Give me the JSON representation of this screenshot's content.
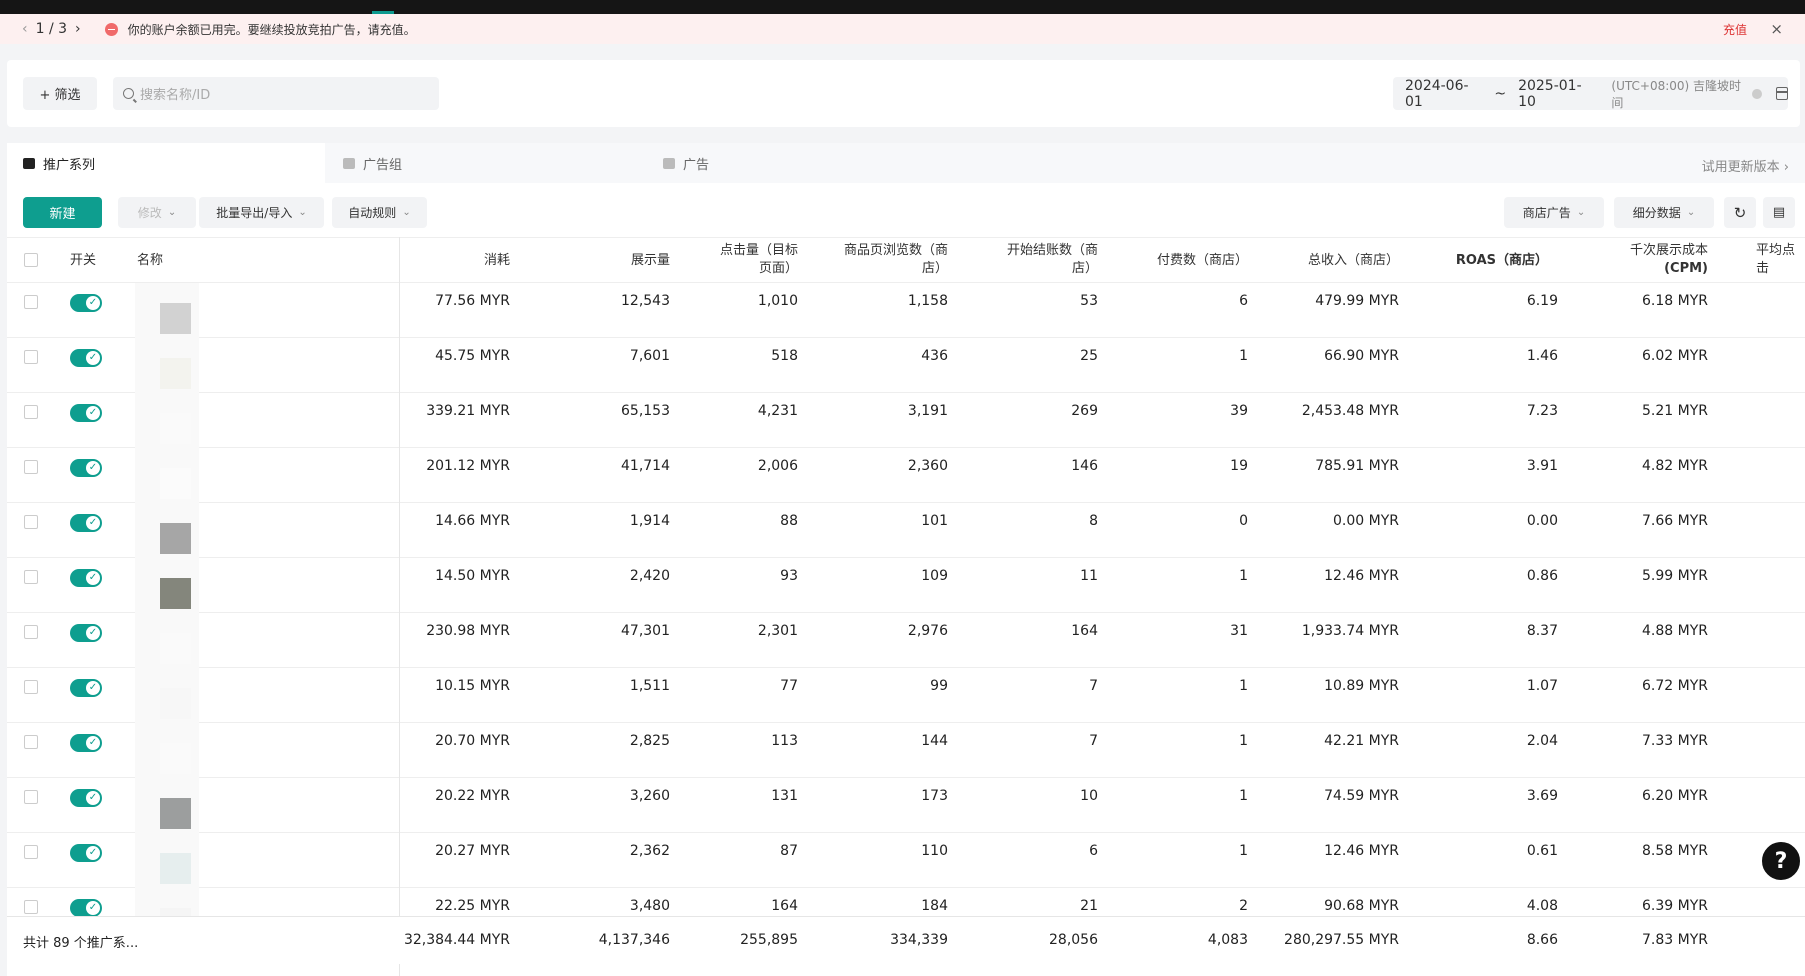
{
  "alert": {
    "page_indicator": "1 / 3",
    "message": "你的账户余额已用完。要继续投放竞拍广告，请充值。",
    "recharge_label": "充值"
  },
  "filter": {
    "filter_button_label": "+ 筛选",
    "search_placeholder": "搜索名称/ID",
    "start_date": "2024-06-01",
    "separator": "~",
    "end_date": "2025-01-10",
    "timezone": "(UTC+08:00) 吉隆坡时间"
  },
  "tabs": [
    {
      "label": "推广系列",
      "active": true
    },
    {
      "label": "广告组",
      "active": false
    },
    {
      "label": "广告",
      "active": false
    }
  ],
  "try_new_version": "试用更新版本",
  "toolbar": {
    "new_label": "新建",
    "edit_label": "修改",
    "batch_label": "批量导出/导入",
    "rules_label": "自动规则",
    "shop_ads_label": "商店广告",
    "breakdown_label": "细分数据"
  },
  "columns": {
    "onoff": "开关",
    "name": "名称",
    "spend": "消耗",
    "impressions": "展示量",
    "clicks_line1": "点击量（目标",
    "clicks_line2": "页面）",
    "pageviews_line1": "商品页浏览数（商",
    "pageviews_line2": "店）",
    "checkouts_line1": "开始结账数（商",
    "checkouts_line2": "店）",
    "payments": "付费数（商店）",
    "revenue": "总收入（商店）",
    "roas": "ROAS（商店）",
    "cpm_line1": "千次展示成本",
    "cpm_line2": "(CPM)",
    "avg_click": "平均点击"
  },
  "rows": [
    {
      "spend": "77.56 MYR",
      "impressions": "12,543",
      "clicks": "1,010",
      "pageviews": "1,158",
      "checkouts": "53",
      "payments": "6",
      "revenue": "479.99 MYR",
      "roas": "6.19",
      "cpm": "6.18 MYR"
    },
    {
      "spend": "45.75 MYR",
      "impressions": "7,601",
      "clicks": "518",
      "pageviews": "436",
      "checkouts": "25",
      "payments": "1",
      "revenue": "66.90 MYR",
      "roas": "1.46",
      "cpm": "6.02 MYR"
    },
    {
      "spend": "339.21 MYR",
      "impressions": "65,153",
      "clicks": "4,231",
      "pageviews": "3,191",
      "checkouts": "269",
      "payments": "39",
      "revenue": "2,453.48 MYR",
      "roas": "7.23",
      "cpm": "5.21 MYR"
    },
    {
      "spend": "201.12 MYR",
      "impressions": "41,714",
      "clicks": "2,006",
      "pageviews": "2,360",
      "checkouts": "146",
      "payments": "19",
      "revenue": "785.91 MYR",
      "roas": "3.91",
      "cpm": "4.82 MYR"
    },
    {
      "spend": "14.66 MYR",
      "impressions": "1,914",
      "clicks": "88",
      "pageviews": "101",
      "checkouts": "8",
      "payments": "0",
      "revenue": "0.00 MYR",
      "roas": "0.00",
      "cpm": "7.66 MYR"
    },
    {
      "spend": "14.50 MYR",
      "impressions": "2,420",
      "clicks": "93",
      "pageviews": "109",
      "checkouts": "11",
      "payments": "1",
      "revenue": "12.46 MYR",
      "roas": "0.86",
      "cpm": "5.99 MYR"
    },
    {
      "spend": "230.98 MYR",
      "impressions": "47,301",
      "clicks": "2,301",
      "pageviews": "2,976",
      "checkouts": "164",
      "payments": "31",
      "revenue": "1,933.74 MYR",
      "roas": "8.37",
      "cpm": "4.88 MYR"
    },
    {
      "spend": "10.15 MYR",
      "impressions": "1,511",
      "clicks": "77",
      "pageviews": "99",
      "checkouts": "7",
      "payments": "1",
      "revenue": "10.89 MYR",
      "roas": "1.07",
      "cpm": "6.72 MYR"
    },
    {
      "spend": "20.70 MYR",
      "impressions": "2,825",
      "clicks": "113",
      "pageviews": "144",
      "checkouts": "7",
      "payments": "1",
      "revenue": "42.21 MYR",
      "roas": "2.04",
      "cpm": "7.33 MYR"
    },
    {
      "spend": "20.22 MYR",
      "impressions": "3,260",
      "clicks": "131",
      "pageviews": "173",
      "checkouts": "10",
      "payments": "1",
      "revenue": "74.59 MYR",
      "roas": "3.69",
      "cpm": "6.20 MYR"
    },
    {
      "spend": "20.27 MYR",
      "impressions": "2,362",
      "clicks": "87",
      "pageviews": "110",
      "checkouts": "6",
      "payments": "1",
      "revenue": "12.46 MYR",
      "roas": "0.61",
      "cpm": "8.58 MYR"
    },
    {
      "spend": "22.25 MYR",
      "impressions": "3,480",
      "clicks": "164",
      "pageviews": "184",
      "checkouts": "21",
      "payments": "2",
      "revenue": "90.68 MYR",
      "roas": "4.08",
      "cpm": "6.39 MYR"
    }
  ],
  "footer": {
    "count_label": "共计 89 个推广系...",
    "spend": "32,384.44 MYR",
    "impressions": "4,137,346",
    "clicks": "255,895",
    "pageviews": "334,339",
    "checkouts": "28,056",
    "payments": "4,083",
    "revenue": "280,297.55 MYR",
    "roas": "8.66",
    "cpm": "7.83 MYR"
  },
  "colors": {
    "accent": "#0e9e8f",
    "alert_bg": "#fdf0f0",
    "alert_link": "#dd3333"
  },
  "icons": [
    "chevron-left-icon",
    "chevron-right-icon",
    "alert-icon",
    "close-icon",
    "search-icon",
    "info-icon",
    "calendar-icon",
    "folder-icon",
    "refresh-icon",
    "export-icon",
    "toggle-check-icon",
    "help-icon"
  ]
}
